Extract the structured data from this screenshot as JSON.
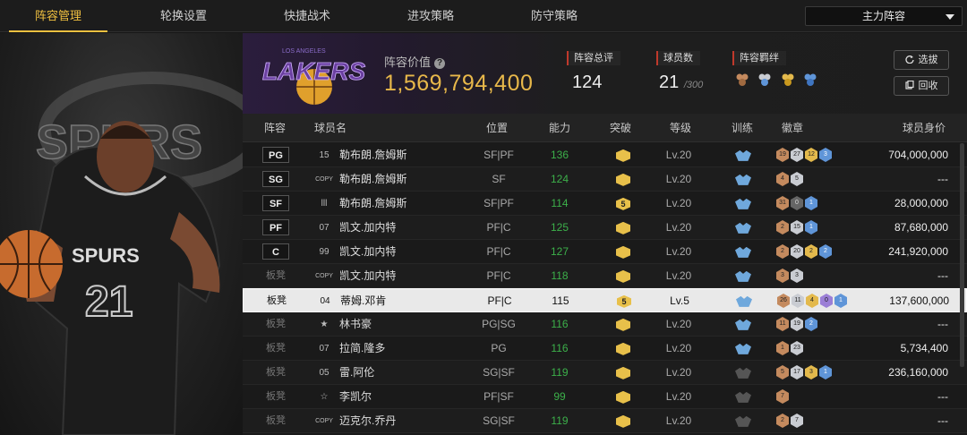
{
  "tabs": [
    {
      "label": "阵容管理",
      "active": true
    },
    {
      "label": "轮换设置",
      "active": false
    },
    {
      "label": "快捷战术",
      "active": false
    },
    {
      "label": "进攻策略",
      "active": false
    },
    {
      "label": "防守策略",
      "active": false
    }
  ],
  "lineup_select": {
    "value": "主力阵容"
  },
  "hero": {
    "jersey_text": "SPURS",
    "jersey_number": "21",
    "bg_text": "SPURS"
  },
  "header": {
    "team_logo_text": "LAKERS",
    "team_logo_subtext": "LOS ANGELES",
    "value_label": "阵容价值",
    "value": "1,569,794,400",
    "stats": [
      {
        "label": "阵容总评",
        "value": "124",
        "sub": ""
      },
      {
        "label": "球员数",
        "value": "21",
        "sub": "/300"
      },
      {
        "label": "阵容羁绊",
        "value": "",
        "sub": ""
      }
    ],
    "bond_icons": [
      "bond-icon-bronze",
      "bond-icon-silver",
      "bond-icon-gold",
      "bond-icon-blue"
    ],
    "buttons": {
      "pick": "选拔",
      "recycle": "回收"
    }
  },
  "columns": {
    "lineup": "阵容",
    "name": "球员名",
    "position": "位置",
    "rating": "能力",
    "breakthrough": "突破",
    "level": "等级",
    "training": "训练",
    "badges": "徽章",
    "worth": "球员身价"
  },
  "rows": [
    {
      "slot": "PG",
      "jersey": "15",
      "name": "勒布朗.詹姆斯",
      "position": "SF|PF",
      "rating": "136",
      "bt": "",
      "level": "Lv.20",
      "train": true,
      "badges": [
        [
          "bronze",
          "19"
        ],
        [
          "silver",
          "27"
        ],
        [
          "gold",
          "12"
        ],
        [
          "blue",
          "3"
        ]
      ],
      "worth": "704,000,000"
    },
    {
      "slot": "SG",
      "jersey": "COPY",
      "name": "勒布朗.詹姆斯",
      "position": "SF",
      "rating": "124",
      "bt": "",
      "level": "Lv.20",
      "train": true,
      "badges": [
        [
          "bronze",
          "4"
        ],
        [
          "silver",
          "5"
        ]
      ],
      "worth": "---"
    },
    {
      "slot": "SF",
      "jersey": "lll",
      "name": "勒布朗.詹姆斯",
      "position": "SF|PF",
      "rating": "114",
      "bt": "5",
      "level": "Lv.20",
      "train": true,
      "badges": [
        [
          "bronze",
          "31"
        ],
        [
          "dark",
          "0"
        ],
        [
          "blue",
          "1"
        ]
      ],
      "worth": "28,000,000"
    },
    {
      "slot": "PF",
      "jersey": "07",
      "name": "凯文.加内特",
      "position": "PF|C",
      "rating": "125",
      "bt": "",
      "level": "Lv.20",
      "train": true,
      "badges": [
        [
          "bronze",
          "2"
        ],
        [
          "silver",
          "15"
        ],
        [
          "blue",
          "1"
        ]
      ],
      "worth": "87,680,000"
    },
    {
      "slot": "C",
      "jersey": "99",
      "name": "凯文.加内特",
      "position": "PF|C",
      "rating": "127",
      "bt": "",
      "level": "Lv.20",
      "train": true,
      "badges": [
        [
          "bronze",
          "2"
        ],
        [
          "silver",
          "20"
        ],
        [
          "gold",
          "2"
        ],
        [
          "blue",
          "2"
        ]
      ],
      "worth": "241,920,000"
    },
    {
      "slot": "板凳",
      "jersey": "COPY",
      "name": "凯文.加内特",
      "position": "PF|C",
      "rating": "118",
      "bt": "",
      "level": "Lv.20",
      "train": true,
      "badges": [
        [
          "bronze",
          "3"
        ],
        [
          "silver",
          "3"
        ]
      ],
      "worth": "---"
    },
    {
      "slot": "板凳",
      "jersey": "04",
      "name": "蒂姆.邓肯",
      "position": "PF|C",
      "rating": "115",
      "bt": "5",
      "level": "Lv.5",
      "train": true,
      "badges": [
        [
          "bronze",
          "26"
        ],
        [
          "silver",
          "11"
        ],
        [
          "gold",
          "4"
        ],
        [
          "purple",
          "0"
        ],
        [
          "blue",
          "1"
        ]
      ],
      "worth": "137,600,000",
      "selected": true
    },
    {
      "slot": "板凳",
      "jersey": "★",
      "name": "林书豪",
      "position": "PG|SG",
      "rating": "116",
      "bt": "",
      "level": "Lv.20",
      "train": true,
      "badges": [
        [
          "bronze",
          "11"
        ],
        [
          "silver",
          "19"
        ],
        [
          "blue",
          "2"
        ]
      ],
      "worth": "---"
    },
    {
      "slot": "板凳",
      "jersey": "07",
      "name": "拉简.隆多",
      "position": "PG",
      "rating": "116",
      "bt": "",
      "level": "Lv.20",
      "train": true,
      "badges": [
        [
          "bronze",
          "1"
        ],
        [
          "silver",
          "23"
        ]
      ],
      "worth": "5,734,400"
    },
    {
      "slot": "板凳",
      "jersey": "05",
      "name": "雷.阿伦",
      "position": "SG|SF",
      "rating": "119",
      "bt": "",
      "level": "Lv.20",
      "train": false,
      "badges": [
        [
          "bronze",
          "5"
        ],
        [
          "silver",
          "17"
        ],
        [
          "gold",
          "3"
        ],
        [
          "blue",
          "1"
        ]
      ],
      "worth": "236,160,000"
    },
    {
      "slot": "板凳",
      "jersey": "☆",
      "name": "李凯尔",
      "position": "PF|SF",
      "rating": "99",
      "bt": "",
      "level": "Lv.20",
      "train": false,
      "badges": [
        [
          "bronze",
          "7"
        ]
      ],
      "worth": "---"
    },
    {
      "slot": "板凳",
      "jersey": "COPY",
      "name": "迈克尔.乔丹",
      "position": "SG|SF",
      "rating": "119",
      "bt": "",
      "level": "Lv.20",
      "train": false,
      "badges": [
        [
          "bronze",
          "2"
        ],
        [
          "silver",
          "7"
        ]
      ],
      "worth": "---"
    }
  ]
}
